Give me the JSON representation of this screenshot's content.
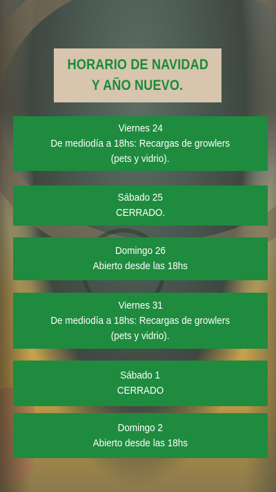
{
  "title": {
    "line1": "HORARIO DE NAVIDAD",
    "line2": "Y AÑO NUEVO."
  },
  "schedule": [
    {
      "day": "Viernes 24",
      "lines": [
        "De mediodía a 18hs: Recargas de growlers",
        "(pets y vidrio)."
      ]
    },
    {
      "day": "Sábado 25",
      "lines": [
        "CERRADO."
      ]
    },
    {
      "day": "Domingo 26",
      "lines": [
        "Abierto desde las 18hs"
      ]
    },
    {
      "day": "Viernes 31",
      "lines": [
        "De mediodía a 18hs: Recargas de growlers",
        "(pets y vidrio)."
      ]
    },
    {
      "day": "Sábado 1",
      "lines": [
        "CERRADO"
      ]
    },
    {
      "day": "Domingo 2",
      "lines": [
        "Abierto desde las 18hs"
      ]
    }
  ],
  "colors": {
    "card_green": "#1f8b3f",
    "title_text_green": "#1b8a3c",
    "title_box_beige": "#d8c5ad",
    "card_text": "#ffffff"
  }
}
